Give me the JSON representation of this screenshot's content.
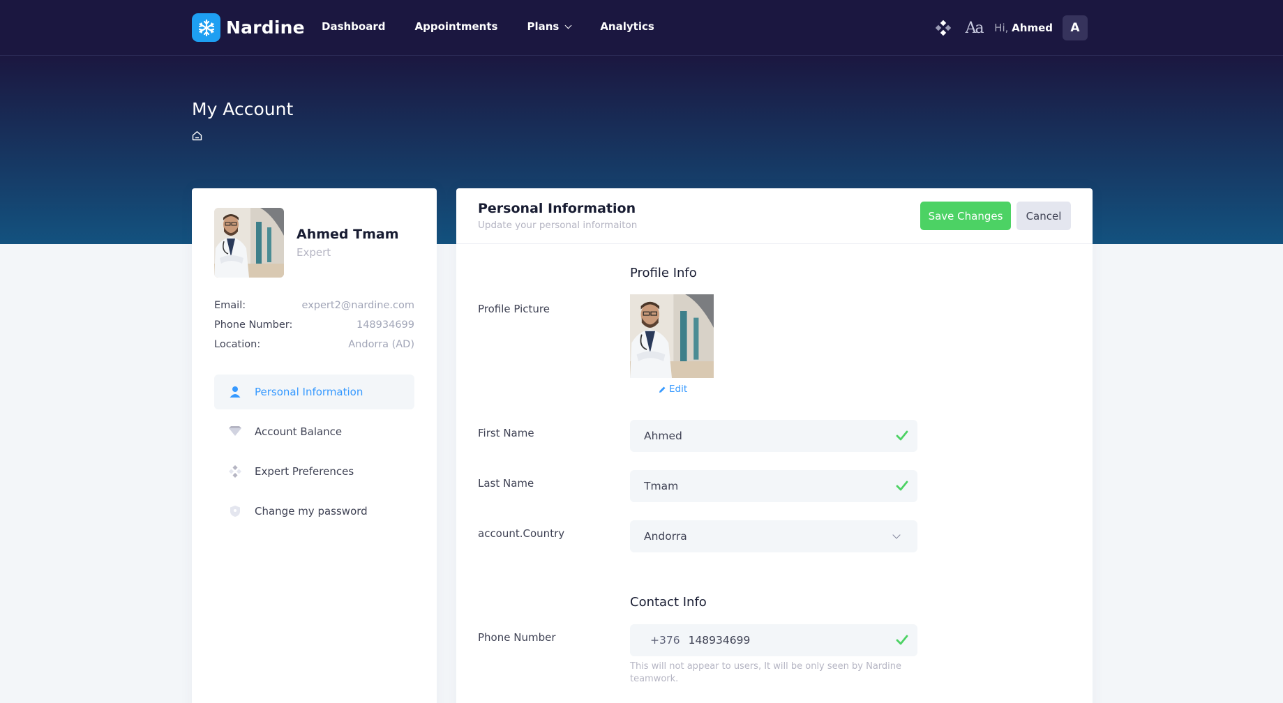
{
  "brand": {
    "name": "Nardine"
  },
  "nav": {
    "items": [
      {
        "label": "Dashboard"
      },
      {
        "label": "Appointments"
      },
      {
        "label": "Plans"
      },
      {
        "label": "Analytics"
      }
    ]
  },
  "user": {
    "greeting": "Hi,",
    "name": "Ahmed",
    "initial": "A"
  },
  "header_icons": {
    "theme": "apps-icon",
    "font": "Aa"
  },
  "page": {
    "title": "My Account"
  },
  "profile": {
    "name": "Ahmed Tmam",
    "role": "Expert",
    "email_label": "Email:",
    "email": "expert2@nardine.com",
    "phone_label": "Phone Number:",
    "phone": "148934699",
    "location_label": "Location:",
    "location": "Andorra (AD)"
  },
  "menu": [
    {
      "label": "Personal Information",
      "icon": "user-icon",
      "active": true
    },
    {
      "label": "Account Balance",
      "icon": "diamond-icon",
      "active": false
    },
    {
      "label": "Expert Preferences",
      "icon": "preferences-icon",
      "active": false
    },
    {
      "label": "Change my password",
      "icon": "shield-icon",
      "active": false
    }
  ],
  "form": {
    "title": "Personal Information",
    "subtitle": "Update your personal informaiton",
    "save_label": "Save Changes",
    "cancel_label": "Cancel",
    "profile_section": "Profile Info",
    "profile_picture_label": "Profile Picture",
    "edit_label": "Edit",
    "first_name_label": "First Name",
    "first_name": "Ahmed",
    "last_name_label": "Last Name",
    "last_name": "Tmam",
    "country_label": "account.Country",
    "country": "Andorra",
    "contact_section": "Contact Info",
    "phone_label": "Phone Number",
    "phone_code": "+376",
    "phone": "148934699",
    "phone_hint": "This will not appear to users, It will be only seen by Nardine teamwork."
  },
  "colors": {
    "header": "#1b1740",
    "accent": "#3699ff",
    "success": "#4cd264",
    "logo": "#1e9ff2"
  }
}
